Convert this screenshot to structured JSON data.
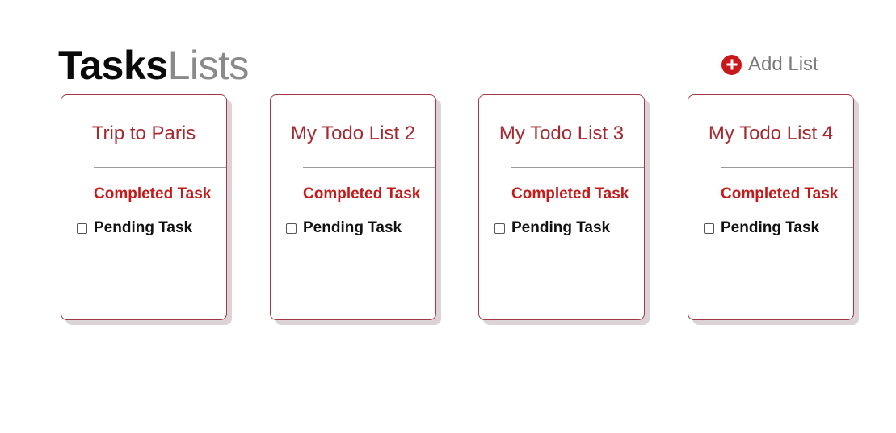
{
  "header": {
    "title_bold": "Tasks",
    "title_light": "Lists"
  },
  "add_list": {
    "icon": "plus-circle-icon",
    "label": "Add List"
  },
  "colors": {
    "accent": "#c8181e",
    "card_title": "#a32a31",
    "completed_task": "#c41a1a",
    "card_border": "#a23845"
  },
  "lists": [
    {
      "title": "Trip to Paris",
      "completed_task": "Completed Task",
      "pending_task": "Pending Task",
      "pending_checked": false
    },
    {
      "title": "My Todo List 2",
      "completed_task": "Completed Task",
      "pending_task": "Pending Task",
      "pending_checked": false
    },
    {
      "title": "My Todo List 3",
      "completed_task": "Completed Task",
      "pending_task": "Pending Task",
      "pending_checked": false
    },
    {
      "title": "My Todo List 4",
      "completed_task": "Completed Task",
      "pending_task": "Pending Task",
      "pending_checked": false
    }
  ]
}
